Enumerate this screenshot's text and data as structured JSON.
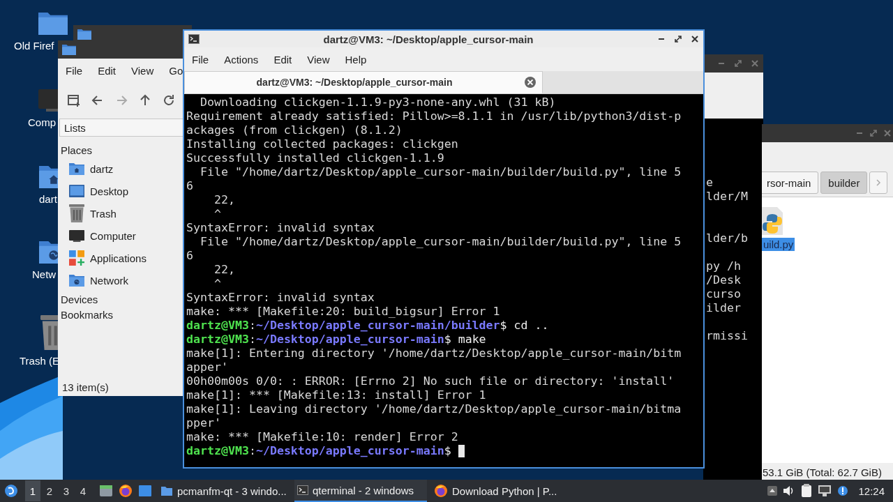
{
  "desktop": {
    "icons": [
      {
        "kind": "folder",
        "label": "Old Firef"
      },
      {
        "kind": "computer",
        "label": "Comp"
      },
      {
        "kind": "home",
        "label": "dart"
      },
      {
        "kind": "network",
        "label": "Netw"
      },
      {
        "kind": "trash",
        "label": "Trash (E"
      }
    ]
  },
  "file_manager": {
    "menu": [
      "File",
      "Edit",
      "View",
      "Go"
    ],
    "toolbar": [
      {
        "kind": "new-tab",
        "disabled": false
      },
      {
        "kind": "back",
        "disabled": false
      },
      {
        "kind": "forward",
        "disabled": true
      },
      {
        "kind": "up",
        "disabled": false
      },
      {
        "kind": "reload",
        "disabled": false
      }
    ],
    "side_pane_mode": "Lists",
    "places_header": "Places",
    "places": [
      {
        "kind": "home",
        "label": "dartz"
      },
      {
        "kind": "desktop",
        "label": "Desktop"
      },
      {
        "kind": "trash",
        "label": "Trash"
      },
      {
        "kind": "computer",
        "label": "Computer"
      },
      {
        "kind": "applications",
        "label": "Applications"
      },
      {
        "kind": "network",
        "label": "Network"
      }
    ],
    "sections": [
      "Devices",
      "Bookmarks"
    ],
    "status": "13 item(s)"
  },
  "terminal": {
    "title": "dartz@VM3: ~/Desktop/apple_cursor-main",
    "menu": [
      "File",
      "Actions",
      "Edit",
      "View",
      "Help"
    ],
    "tabs": [
      {
        "label": "dartz@VM3: ~/Desktop/apple_cursor-main",
        "selected": true
      }
    ],
    "lines": [
      {
        "kind": "output",
        "text": "  Downloading clickgen-1.1.9-py3-none-any.whl (31 kB)"
      },
      {
        "kind": "output",
        "text": "Requirement already satisfied: Pillow>=8.1.1 in /usr/lib/python3/dist-p"
      },
      {
        "kind": "output",
        "text": "ackages (from clickgen) (8.1.2)"
      },
      {
        "kind": "output",
        "text": "Installing collected packages: clickgen"
      },
      {
        "kind": "output",
        "text": "Successfully installed clickgen-1.1.9"
      },
      {
        "kind": "output",
        "text": "  File \"/home/dartz/Desktop/apple_cursor-main/builder/build.py\", line 5"
      },
      {
        "kind": "output",
        "text": "6"
      },
      {
        "kind": "output",
        "text": "    22,"
      },
      {
        "kind": "output",
        "text": "    ^"
      },
      {
        "kind": "output",
        "text": "SyntaxError: invalid syntax"
      },
      {
        "kind": "output",
        "text": "  File \"/home/dartz/Desktop/apple_cursor-main/builder/build.py\", line 5"
      },
      {
        "kind": "output",
        "text": "6"
      },
      {
        "kind": "output",
        "text": "    22,"
      },
      {
        "kind": "output",
        "text": "    ^"
      },
      {
        "kind": "output",
        "text": "SyntaxError: invalid syntax"
      },
      {
        "kind": "output",
        "text": "make: *** [Makefile:20: build_bigsur] Error 1"
      },
      {
        "kind": "prompt",
        "user": "dartz@VM3",
        "separator": ":",
        "path": "~/Desktop/apple_cursor-main/builder",
        "command": "$ cd ..",
        "cursor": false
      },
      {
        "kind": "prompt",
        "user": "dartz@VM3",
        "separator": ":",
        "path": "~/Desktop/apple_cursor-main",
        "command": "$ make",
        "cursor": false
      },
      {
        "kind": "output",
        "text": "make[1]: Entering directory '/home/dartz/Desktop/apple_cursor-main/bitm"
      },
      {
        "kind": "output",
        "text": "apper'"
      },
      {
        "kind": "output",
        "text": "00h00m00s 0/0: : ERROR: [Errno 2] No such file or directory: 'install'"
      },
      {
        "kind": "output",
        "text": "make[1]: *** [Makefile:13: install] Error 1"
      },
      {
        "kind": "output",
        "text": "make[1]: Leaving directory '/home/dartz/Desktop/apple_cursor-main/bitma"
      },
      {
        "kind": "output",
        "text": "pper'"
      },
      {
        "kind": "output",
        "text": "make: *** [Makefile:10: render] Error 2"
      },
      {
        "kind": "prompt",
        "user": "dartz@VM3",
        "separator": ":",
        "path": "~/Desktop/apple_cursor-main",
        "command": "$ ",
        "cursor": true
      }
    ]
  },
  "back_terminal": {
    "lines": [
      "e",
      "lder/M",
      "lder/b",
      "py /h",
      "/Desk",
      "curso",
      "ilder",
      "rmissi"
    ]
  },
  "file_manager_2": {
    "path": [
      {
        "label": "rsor-main",
        "selected": false
      },
      {
        "label": "builder",
        "selected": true
      }
    ],
    "files": [
      {
        "kind": "python",
        "label": "uild.py",
        "selected": true
      }
    ],
    "status": "53.1 GiB (Total: 62.7 GiB)"
  },
  "taskbar": {
    "workspaces": [
      {
        "label": "1",
        "selected": true
      },
      {
        "label": "2",
        "selected": false
      },
      {
        "label": "3",
        "selected": false
      },
      {
        "label": "4",
        "selected": false
      }
    ],
    "tasks": [
      {
        "kind": "folder",
        "label": "pcmanfm-qt - 3 windo...",
        "selected": false
      },
      {
        "kind": "terminal",
        "label": "qterminal - 2 windows",
        "selected": true
      },
      {
        "kind": "browser",
        "label": "Download Python | P...",
        "selected": false
      }
    ],
    "clock": "12:24"
  }
}
